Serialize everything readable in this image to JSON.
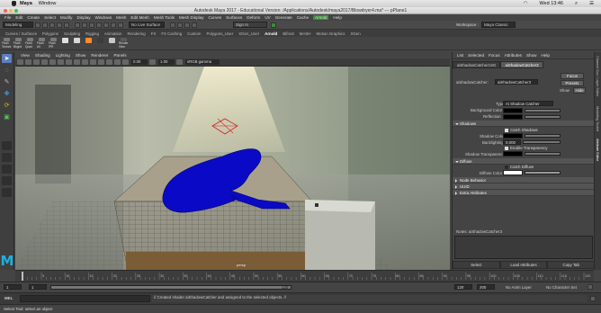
{
  "mac": {
    "apple_icon": "apple-icon",
    "app": "Maya",
    "menu": "Window",
    "time": "Wed 13:46"
  },
  "window": {
    "title": "Autodesk Maya 2017 - Educational Version: /Applications/Autodesk/maya2017/Blowdryer4.ma* --- pPlane1"
  },
  "menubar": [
    "File",
    "Edit",
    "Create",
    "Select",
    "Modify",
    "Display",
    "Windows",
    "Mesh",
    "Edit Mesh",
    "Mesh Tools",
    "Mesh Display",
    "Curves",
    "Surfaces",
    "Deform",
    "UV",
    "Generate",
    "Cache",
    "Arnold",
    "Help"
  ],
  "statusline": {
    "mode": "Modeling",
    "live_surface": "No Live Surface",
    "sign_in": "Sign In",
    "workspace_label": "Workspace :",
    "workspace": "Maya Classic"
  },
  "shelf_tabs": [
    "Curves / Surfaces",
    "Polygons",
    "Sculpting",
    "Rigging",
    "Animation",
    "Rendering",
    "FX",
    "FX Caching",
    "Custom",
    "Polygons_User",
    "XGen_User",
    "Arnold",
    "Bifrost",
    "MASH",
    "Motion Graphics",
    "XGen"
  ],
  "shelf_active": "Arnold",
  "shelf_buttons": [
    {
      "label": "Flush Texture"
    },
    {
      "label": "Flush Bkgnd"
    },
    {
      "label": "Flush Quad"
    },
    {
      "label": "Flush All"
    },
    {
      "label": "Flush IPR"
    },
    {
      "label": ""
    },
    {
      "label": ""
    },
    {
      "label": ""
    },
    {
      "label": ""
    },
    {
      "label": ""
    },
    {
      "label": "Render View"
    }
  ],
  "viewport_menu": [
    "View",
    "Shading",
    "Lighting",
    "Show",
    "Renderer",
    "Panels"
  ],
  "viewport_toolbar": {
    "field1": "0.00",
    "field2": "1.00",
    "color_space": "sRGB gamma"
  },
  "camera_label": "persp",
  "attr_editor": {
    "menu": [
      "List",
      "Selected",
      "Focus",
      "Attributes",
      "Show",
      "Help"
    ],
    "tabs": [
      "aiShadowCatcher1SG",
      "aiShadowCatcher3"
    ],
    "node_label": "aiShadowCatcher:",
    "node_name": "aiShadowCatcher3",
    "buttons": {
      "focus": "Focus",
      "presets": "Presets",
      "show": "Show",
      "hide": "Hide"
    },
    "type_label": "Type",
    "type_value": "Ai Shadow Catcher",
    "background_color": "Background Color",
    "reflection": "Reflection",
    "shadows_section": "Shadows",
    "catch_shadows": "Catch Shadows",
    "shadow_color": "Shadow Color",
    "backlighting": "Backlighting",
    "backlighting_value": "0.000",
    "enable_transparency": "Enable Transparency",
    "shadow_transparency": "Shadow Transparency",
    "diffuse_section": "Diffuse",
    "catch_diffuse": "Catch Diffuse",
    "diffuse_color": "Diffuse Color",
    "node_behavior": "Node Behavior",
    "uuid": "UUID",
    "extra_attributes": "Extra Attributes",
    "notes": "Notes:  aiShadowCatcher3",
    "bottom": [
      "Select",
      "Load Attributes",
      "Copy Tab"
    ]
  },
  "side_tabs": [
    "Channel Box / Layer Editor",
    "Modelling Toolkit",
    "Attribute Editor"
  ],
  "timeline": {
    "ticks": [
      "5",
      "10",
      "15",
      "20",
      "25",
      "30",
      "35",
      "40",
      "45",
      "50",
      "55",
      "60",
      "65",
      "70",
      "75",
      "80",
      "85",
      "90",
      "95",
      "100",
      "105",
      "110",
      "115",
      "120"
    ],
    "current": "1"
  },
  "range": {
    "start": "1",
    "start2": "1",
    "end_marker": "120",
    "end": "120",
    "end2": "200",
    "anim_layer": "No Anim Layer",
    "char_set": "No Character Set"
  },
  "command_line": {
    "lang": "MEL",
    "result": "// Created shader aiShadowCatcher and assigned to the selected objects. //"
  },
  "help_line": "Select Tool: select an object",
  "colors": {
    "object": "#0a0ac6",
    "accent": "#22aedd",
    "locator": "#cc2222"
  }
}
